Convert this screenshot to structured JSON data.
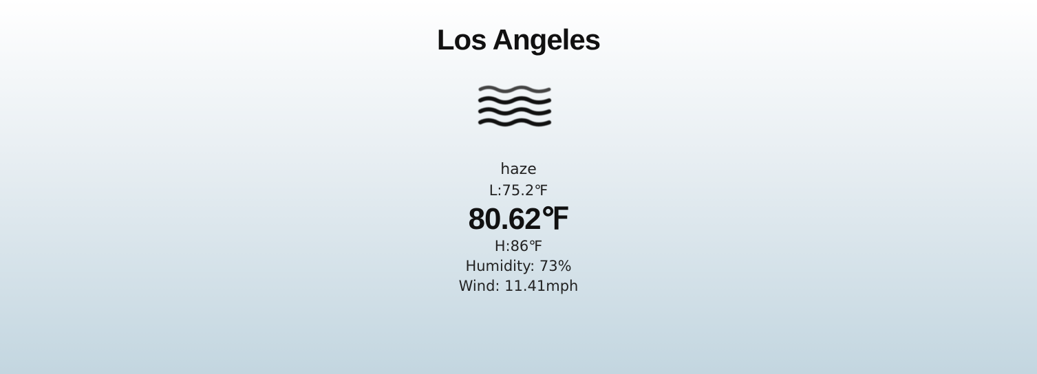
{
  "weather": {
    "city": "Los Angeles",
    "icon": "haze-icon",
    "description": "haze",
    "low": "L:75.2℉",
    "temperature": "80.62℉",
    "high": "H:86℉",
    "humidity": "Humidity: 73%",
    "wind": "Wind: 11.41mph"
  },
  "colors": {
    "background_top": "#ffffff",
    "background_bottom": "#c3d6e0",
    "text": "#111111"
  }
}
